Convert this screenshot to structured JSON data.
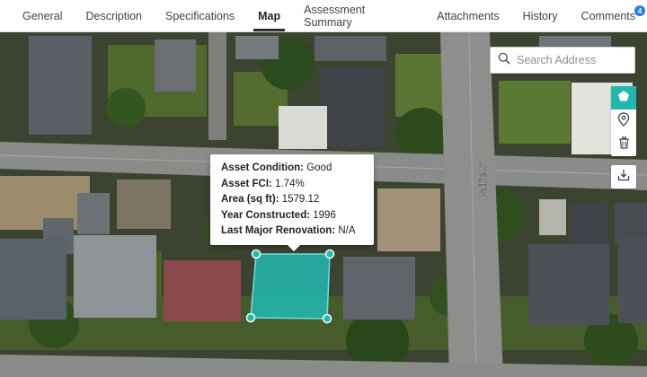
{
  "tabs": [
    {
      "label": "General"
    },
    {
      "label": "Description"
    },
    {
      "label": "Specifications"
    },
    {
      "label": "Map"
    },
    {
      "label": "Assessment Summary"
    },
    {
      "label": "Attachments"
    },
    {
      "label": "History"
    },
    {
      "label": "Comments",
      "badge": "4"
    }
  ],
  "search": {
    "placeholder": "Search Address",
    "icon": "search-icon"
  },
  "map": {
    "street_label": "Baillie St",
    "highlight_color": "#22b8b0"
  },
  "tools": [
    "polygon-icon",
    "pin-icon",
    "trash-icon",
    "download-icon"
  ],
  "popup": {
    "rows": [
      {
        "label": "Asset Condition:",
        "value": "Good"
      },
      {
        "label": "Asset FCI:",
        "value": "1.74%"
      },
      {
        "label": "Area (sq ft):",
        "value": "1579.12"
      },
      {
        "label": "Year Constructed:",
        "value": "1996"
      },
      {
        "label": "Last Major Renovation:",
        "value": "N/A"
      }
    ]
  }
}
